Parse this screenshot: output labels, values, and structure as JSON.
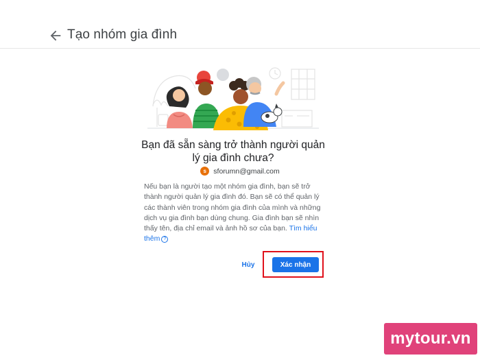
{
  "header": {
    "back_icon": "arrow-left-icon",
    "title": "Tạo nhóm gia đình"
  },
  "main": {
    "illustration_icon": "family-illustration",
    "heading": "Bạn đã sẵn sàng trở thành người quản lý gia đình chưa?",
    "account": {
      "avatar_letter": "s",
      "email": "sforumn@gmail.com",
      "avatar_color": "#e8710a"
    },
    "description": "Nếu bạn là người tạo một nhóm gia đình, bạn sẽ trở thành người quản lý gia đình đó. Bạn sẽ có thể quản lý các thành viên trong nhóm gia đình của mình và những dịch vụ gia đình bạn dùng chung. Gia đình bạn sẽ nhìn thấy tên, địa chỉ email và ảnh hồ sơ của bạn.",
    "learn_more": "Tìm hiểu thêm",
    "help_icon": "question-circle-icon",
    "help_glyph": "?"
  },
  "actions": {
    "cancel_label": "Hủy",
    "confirm_label": "Xác nhận"
  },
  "watermark": {
    "text": "mytour.vn",
    "color": "#e0427a"
  },
  "colors": {
    "accent": "#1a73e8",
    "highlight": "#e0101a"
  }
}
